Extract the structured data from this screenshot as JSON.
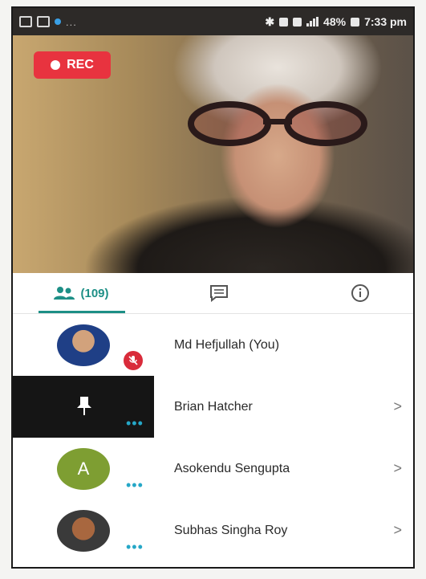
{
  "status_bar": {
    "time": "7:33 pm",
    "battery": "48%",
    "more_indicator": "..."
  },
  "video": {
    "rec_label": "REC"
  },
  "tabs": {
    "participants_count": "(109)"
  },
  "participants": [
    {
      "name": "Md Hefjullah (You)",
      "avatar": "photo",
      "muted": true
    },
    {
      "name": "Brian Hatcher",
      "avatar": "pin",
      "more": "•••"
    },
    {
      "name": "Asokendu Sengupta",
      "avatar_letter": "A",
      "more": "•••"
    },
    {
      "name": "Subhas Singha Roy",
      "avatar": "photo",
      "more": "•••"
    }
  ],
  "chevron": ">",
  "colors": {
    "accent": "#1d8f86",
    "rec_red": "#e8333f",
    "mute_red": "#d92b3a",
    "avatar_green": "#7e9e32",
    "more_dots": "#25a7c7"
  }
}
